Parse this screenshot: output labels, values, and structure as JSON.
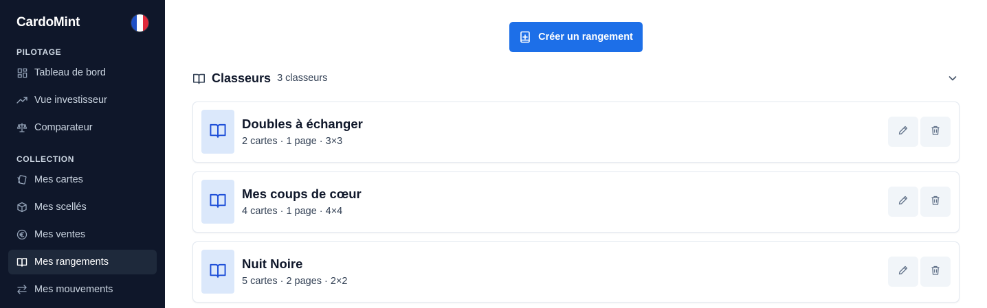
{
  "app": {
    "name": "CardoMint",
    "language_flag": "fr-flag"
  },
  "sidebar": {
    "sections": [
      {
        "label": "PILOTAGE",
        "items": [
          {
            "label": "Tableau de bord",
            "icon": "dashboard-grid-icon",
            "active": false
          },
          {
            "label": "Vue investisseur",
            "icon": "trending-up-icon",
            "active": false
          },
          {
            "label": "Comparateur",
            "icon": "scale-icon",
            "active": false
          }
        ]
      },
      {
        "label": "COLLECTION",
        "items": [
          {
            "label": "Mes cartes",
            "icon": "cards-icon",
            "active": false
          },
          {
            "label": "Mes scellés",
            "icon": "package-icon",
            "active": false
          },
          {
            "label": "Mes ventes",
            "icon": "euro-circle-icon",
            "active": false
          },
          {
            "label": "Mes rangements",
            "icon": "book-open-icon",
            "active": true
          },
          {
            "label": "Mes mouvements",
            "icon": "arrows-swap-icon",
            "active": false
          }
        ]
      }
    ]
  },
  "main": {
    "create_button": {
      "label": "Créer un rangement",
      "icon": "book-plus-icon",
      "color": "#1d6fe8"
    },
    "section": {
      "title": "Classeurs",
      "count": "3 classeurs",
      "icon": "book-open-icon",
      "toggle_icon": "chevron-down-icon"
    },
    "binders": [
      {
        "name": "Doubles à échanger",
        "cards": "2 cartes",
        "pages": "1 page",
        "grid": "3×3"
      },
      {
        "name": "Mes coups de cœur",
        "cards": "4 cartes",
        "pages": "1 page",
        "grid": "4×4"
      },
      {
        "name": "Nuit Noire",
        "cards": "5 cartes",
        "pages": "2 pages",
        "grid": "2×2"
      }
    ]
  },
  "colors": {
    "sidebar_bg": "#0f172a",
    "accent": "#1d6fe8",
    "thumb_bg": "#dbe8fb"
  }
}
